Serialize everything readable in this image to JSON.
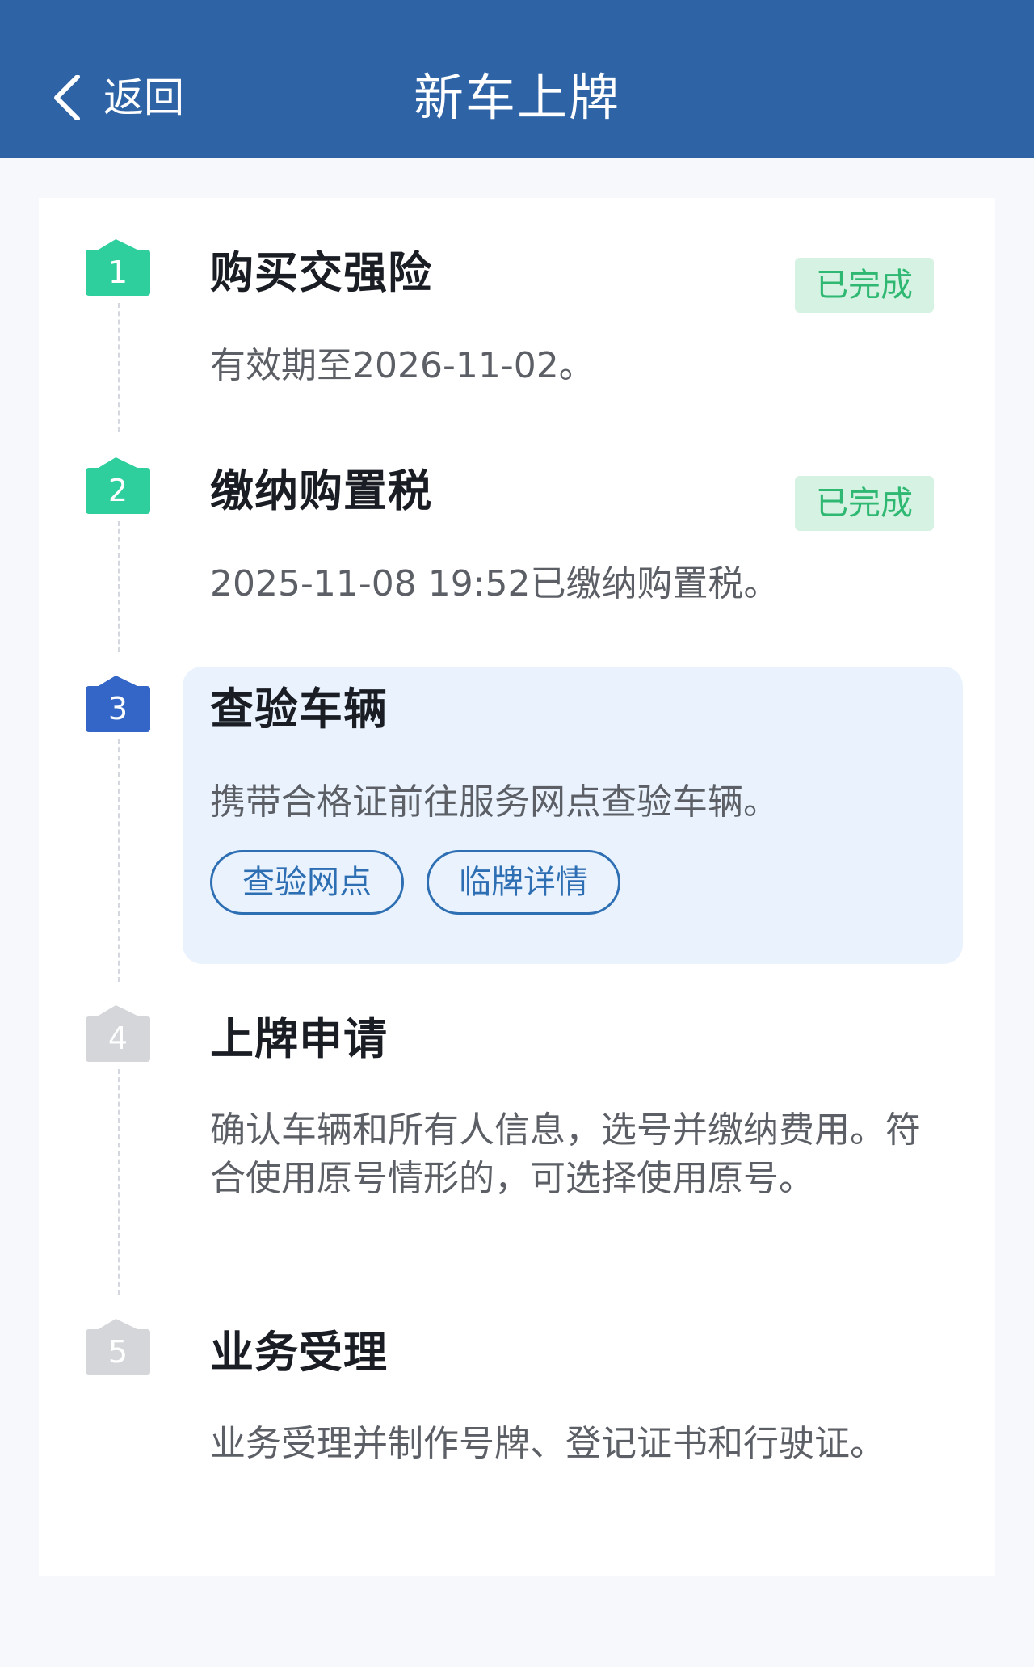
{
  "header": {
    "back_label": "返回",
    "title": "新车上牌"
  },
  "steps": [
    {
      "number": "1",
      "title": "购买交强险",
      "status": "已完成",
      "description": "有效期至2026-11-02。"
    },
    {
      "number": "2",
      "title": "缴纳购置税",
      "status": "已完成",
      "description": "2025-11-08 19:52已缴纳购置税。"
    },
    {
      "number": "3",
      "title": "查验车辆",
      "description": "携带合格证前往服务网点查验车辆。",
      "actions": [
        "查验网点",
        "临牌详情"
      ]
    },
    {
      "number": "4",
      "title": "上牌申请",
      "description": "确认车辆和所有人信息，选号并缴纳费用。符合使用原号情形的，可选择使用原号。"
    },
    {
      "number": "5",
      "title": "业务受理",
      "description": "业务受理并制作号牌、登记证书和行驶证。"
    }
  ],
  "colors": {
    "header_bg": "#2e63a6",
    "done": "#2ecf9c",
    "current": "#3466c8",
    "pending": "#d4d6da",
    "status_text": "#2eb872",
    "link": "#2e6fb4"
  }
}
